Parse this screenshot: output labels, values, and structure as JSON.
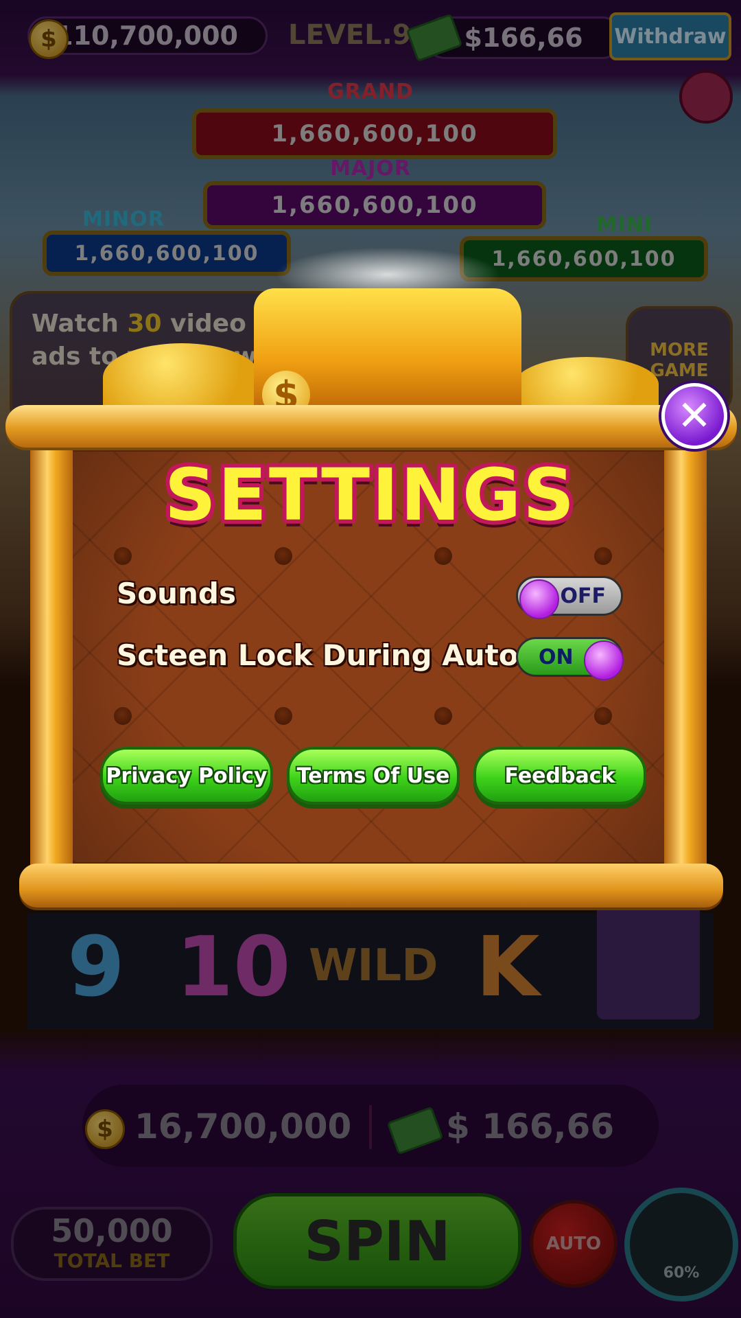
{
  "top_bar": {
    "coins": "110,700,000",
    "level": "LEVEL.9",
    "cash": "$166,66",
    "withdraw_label": "Withdraw"
  },
  "jackpots": {
    "grand": {
      "label": "GRAND",
      "value": "1,660,600,100"
    },
    "major": {
      "label": "MAJOR",
      "value": "1,660,600,100"
    },
    "minor": {
      "label": "MINOR",
      "value": "1,660,600,100"
    },
    "mini": {
      "label": "MINI",
      "value": "1,660,600,100"
    }
  },
  "side": {
    "watch_text_a": "Watch ",
    "watch_count": "30",
    "watch_text_b": " video",
    "watch_text_c": "ads to withdraw",
    "more_game": "MORE GAME"
  },
  "settings": {
    "title": "SETTINGS",
    "rows": [
      {
        "label": "Sounds",
        "state": "OFF"
      },
      {
        "label": "Scteen Lock During Auto",
        "state": "ON"
      }
    ],
    "buttons": [
      "Privacy Policy",
      "Terms Of Use",
      "Feedback"
    ],
    "close_glyph": "✕"
  },
  "reels": [
    "9",
    "10",
    "WILD",
    "K"
  ],
  "bottom": {
    "coins": "16,700,000",
    "cash": "$ 166,66",
    "total_bet_value": "50,000",
    "total_bet_label": "TOTAL BET",
    "spin_label": "SPIN",
    "auto_label": "AUTO",
    "chest_progress": "60%"
  },
  "colors": {
    "settings_title": "#fff23a",
    "toggle_knob": "#b21ee0",
    "button_green": "#3ed21a"
  }
}
